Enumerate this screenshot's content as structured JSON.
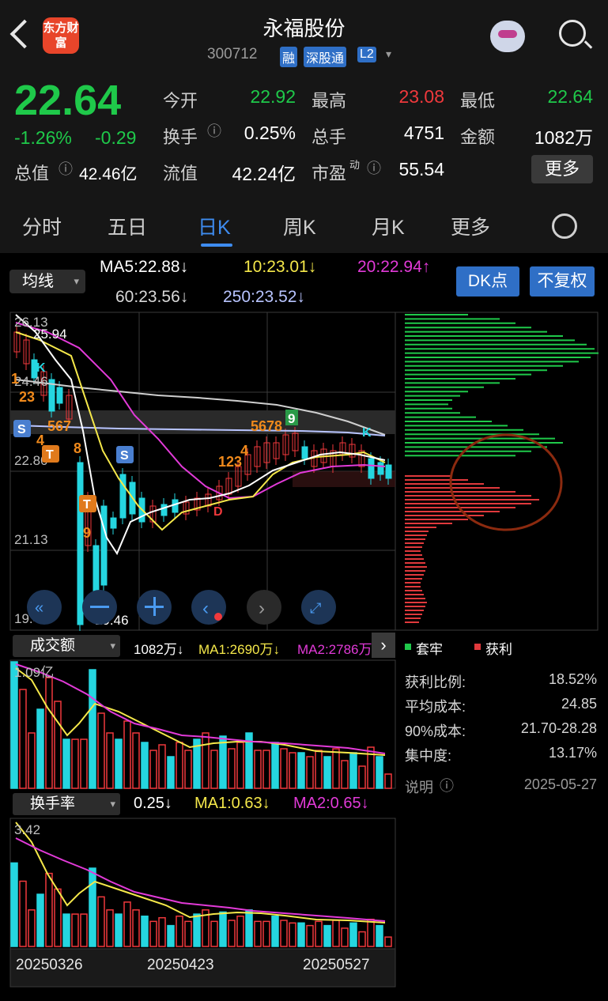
{
  "header": {
    "logo_text": "东方财富",
    "title": "永福股份",
    "code": "300712",
    "tags": [
      "融",
      "深股通",
      "L2"
    ]
  },
  "quote": {
    "price": "22.64",
    "change_pct": "-1.26%",
    "change_abs": "-0.29",
    "open_label": "今开",
    "open": "22.92",
    "high_label": "最高",
    "high": "23.08",
    "low_label": "最低",
    "low": "22.64",
    "turnover_label": "换手",
    "turnover": "0.25%",
    "volume_label": "总手",
    "volume": "4751",
    "amount_label": "金额",
    "amount": "1082万",
    "mktcap_label": "总值",
    "mktcap": "42.46亿",
    "float_label": "流值",
    "float": "42.24亿",
    "pe_label": "市盈",
    "pe_sup": "动",
    "pe": "55.54",
    "more_label": "更多"
  },
  "tabs": [
    "分时",
    "五日",
    "日K",
    "周K",
    "月K",
    "更多"
  ],
  "ma": {
    "selector": "均线",
    "ma5": "MA5:22.88↓",
    "ma10": "10:23.01↓",
    "ma20": "20:22.94↑",
    "ma60": "60:23.56↓",
    "ma250": "250:23.52↓",
    "dk_button": "DK点",
    "fq_button": "不复权"
  },
  "kline": {
    "y_labels": [
      "26.13",
      "24.46",
      "22.80",
      "21.13",
      "19.46"
    ],
    "high_marker": "25.94",
    "low_marker": "19.46",
    "signals": [
      "1",
      "23",
      "4",
      "567",
      "8",
      "9",
      "123",
      "4",
      "5678",
      "9"
    ],
    "badges": [
      "S",
      "T",
      "S",
      "T",
      "K",
      "K",
      "D"
    ]
  },
  "volume": {
    "selector": "成交额",
    "value": "1082万↓",
    "ma1": "MA1:2690万↓",
    "ma2": "MA2:2786万",
    "max_label": "1.09亿"
  },
  "turnover": {
    "selector": "换手率",
    "value": "0.25↓",
    "ma1": "MA1:0.63↓",
    "ma2": "MA2:0.65↓",
    "max_label": "3.42",
    "dates": [
      "20250326",
      "20250423",
      "20250527"
    ]
  },
  "chips": {
    "legend_trapped": "套牢",
    "legend_profit": "获利",
    "stats": [
      {
        "label": "获利比例:",
        "value": "18.52%"
      },
      {
        "label": "平均成本:",
        "value": "24.85"
      },
      {
        "label": "90%成本:",
        "value": "21.70-28.28"
      },
      {
        "label": "集中度:",
        "value": "13.17%"
      }
    ],
    "note_label": "说明",
    "date": "2025-05-27"
  },
  "colors": {
    "up": "#f0393c",
    "down": "#1fc94a",
    "accent": "#3e8cf0",
    "ma5": "#ffffff",
    "ma10": "#f5e84a",
    "ma20": "#e23ad8",
    "ma60": "#cfcfcf",
    "ma250": "#b8c4ff"
  }
}
